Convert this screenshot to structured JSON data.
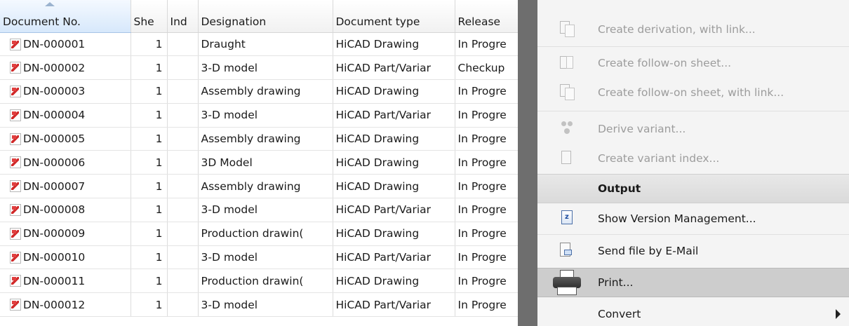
{
  "table": {
    "columns": [
      "Document No.",
      "She",
      "Ind",
      "Designation",
      "Document type",
      "Release"
    ],
    "rows": [
      {
        "doc_no": "DN-000001",
        "sheet": "1",
        "index": "",
        "designation": "Draught",
        "doc_type": "HiCAD Drawing",
        "release": "In Progre"
      },
      {
        "doc_no": "DN-000002",
        "sheet": "1",
        "index": "",
        "designation": "3-D model",
        "doc_type": "HiCAD Part/Variar",
        "release": "Checkup"
      },
      {
        "doc_no": "DN-000003",
        "sheet": "1",
        "index": "",
        "designation": "Assembly drawing",
        "doc_type": "HiCAD Drawing",
        "release": "In Progre"
      },
      {
        "doc_no": "DN-000004",
        "sheet": "1",
        "index": "",
        "designation": "3-D model",
        "doc_type": "HiCAD Part/Variar",
        "release": "In Progre"
      },
      {
        "doc_no": "DN-000005",
        "sheet": "1",
        "index": "",
        "designation": "Assembly drawing",
        "doc_type": "HiCAD Drawing",
        "release": "In Progre"
      },
      {
        "doc_no": "DN-000006",
        "sheet": "1",
        "index": "",
        "designation": "3D Model",
        "doc_type": "HiCAD Drawing",
        "release": "In Progre"
      },
      {
        "doc_no": "DN-000007",
        "sheet": "1",
        "index": "",
        "designation": "Assembly drawing",
        "doc_type": "HiCAD Drawing",
        "release": "In Progre"
      },
      {
        "doc_no": "DN-000008",
        "sheet": "1",
        "index": "",
        "designation": "3-D model",
        "doc_type": "HiCAD Part/Variar",
        "release": "In Progre"
      },
      {
        "doc_no": "DN-000009",
        "sheet": "1",
        "index": "",
        "designation": "Production drawin(",
        "doc_type": "HiCAD Drawing",
        "release": "In Progre"
      },
      {
        "doc_no": "DN-000010",
        "sheet": "1",
        "index": "",
        "designation": "3-D model",
        "doc_type": "HiCAD Part/Variar",
        "release": "In Progre"
      },
      {
        "doc_no": "DN-000011",
        "sheet": "1",
        "index": "",
        "designation": "Production drawin(",
        "doc_type": "HiCAD Drawing",
        "release": "In Progre"
      },
      {
        "doc_no": "DN-000012",
        "sheet": "1",
        "index": "",
        "designation": "3-D model",
        "doc_type": "HiCAD Part/Variar",
        "release": "In Progre"
      }
    ]
  },
  "menu": {
    "items": [
      {
        "label": "Create derivation, with link...",
        "icon": "derivation-link-icon",
        "enabled": false
      },
      {
        "label": "Create follow-on sheet...",
        "icon": "follow-on-sheet-icon",
        "enabled": false
      },
      {
        "label": "Create follow-on sheet, with link...",
        "icon": "follow-on-sheet-link-icon",
        "enabled": false
      },
      {
        "label": "Derive variant...",
        "icon": "derive-variant-icon",
        "enabled": false
      },
      {
        "label": "Create variant index...",
        "icon": "variant-index-icon",
        "enabled": false
      }
    ],
    "output_header": "Output",
    "output_items": [
      {
        "label": "Show Version Management...",
        "icon": "version-management-icon"
      },
      {
        "label": "Send file by E-Mail",
        "icon": "email-file-icon"
      },
      {
        "label": "Print...",
        "icon": "printer-icon"
      },
      {
        "label": "Convert",
        "icon": "",
        "has_submenu": true
      }
    ]
  },
  "colors": {
    "divider": "#6e6e6e",
    "menu_bg": "#f4f4f4",
    "hover_bg": "#cdcdcd",
    "disabled_text": "#9c9c9c",
    "header_sorted": "#d7e8fb"
  }
}
